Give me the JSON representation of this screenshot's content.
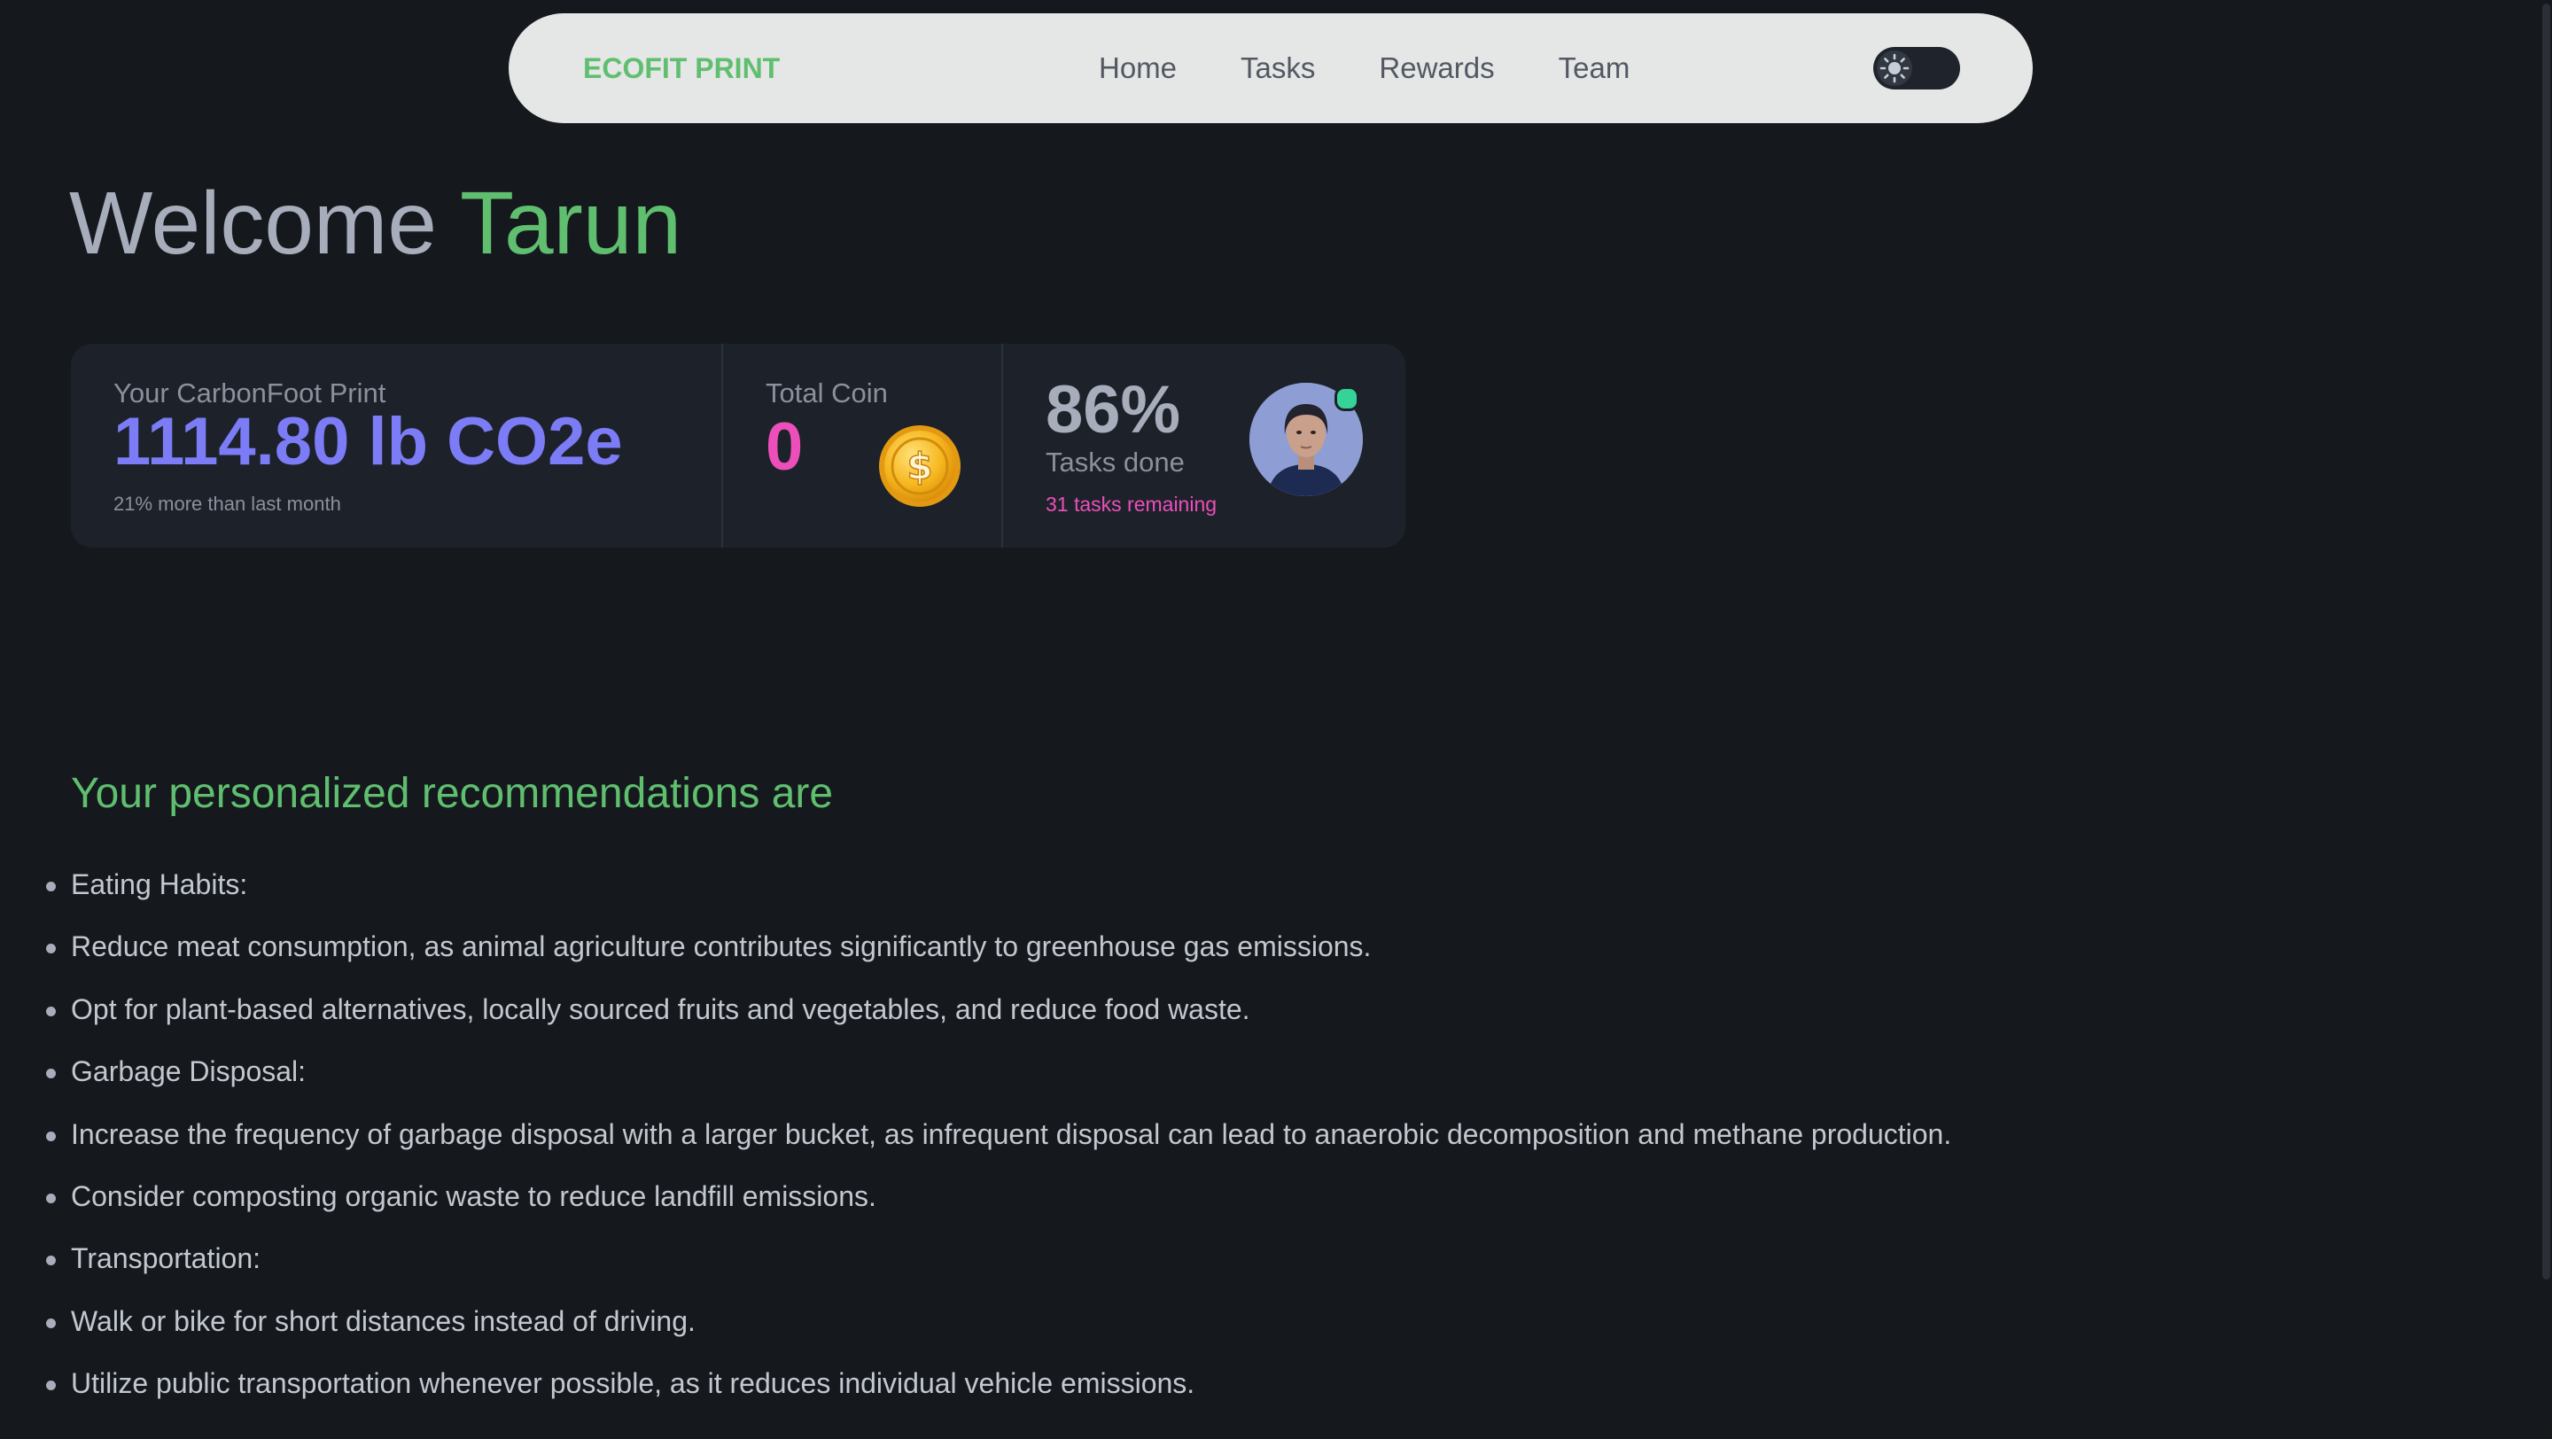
{
  "navbar": {
    "brand": "ECOFIT PRINT",
    "links": [
      "Home",
      "Tasks",
      "Rewards",
      "Team"
    ],
    "theme_toggle_icon": "sun-icon",
    "brand_color": "#5fbf6f"
  },
  "welcome": {
    "prefix": "Welcome",
    "name": "Tarun",
    "name_color": "#5fbf6f"
  },
  "stats": {
    "carbon": {
      "title": "Your CarbonFoot Print",
      "value": "1114.80 lb CO2e",
      "desc": "21% more than last month"
    },
    "coins": {
      "title": "Total Coin",
      "value": "0",
      "icon": "coin-icon"
    },
    "tasks": {
      "value": "86%",
      "title": "Tasks done",
      "remaining": "31 tasks remaining",
      "avatar_status": "online"
    }
  },
  "recommendations": {
    "heading": "Your personalized recommendations are",
    "items": [
      "Eating Habits:",
      "Reduce meat consumption, as animal agriculture contributes significantly to greenhouse gas emissions.",
      "Opt for plant-based alternatives, locally sourced fruits and vegetables, and reduce food waste.",
      "Garbage Disposal:",
      "Increase the frequency of garbage disposal with a larger bucket, as infrequent disposal can lead to anaerobic decomposition and methane production.",
      "Consider composting organic waste to reduce landfill emissions.",
      "Transportation:",
      "Walk or bike for short distances instead of driving.",
      "Utilize public transportation whenever possible, as it reduces individual vehicle emissions."
    ]
  },
  "colors": {
    "background": "#15191e",
    "accent_green": "#5fbf6f",
    "accent_purple": "#7b7cf6",
    "accent_pink": "#ec4fba"
  }
}
